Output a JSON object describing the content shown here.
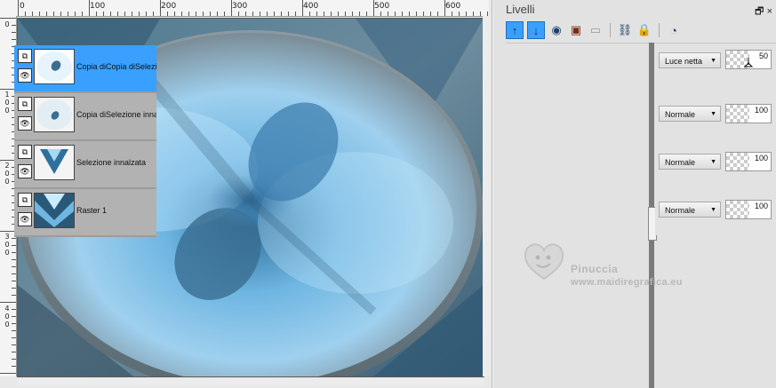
{
  "ruler": {
    "h_labels": [
      "0",
      "100",
      "200",
      "300",
      "400",
      "500",
      "600"
    ],
    "v_labels": [
      "0",
      "1\n0\n0",
      "2\n0\n0",
      "3\n0\n0",
      "4\n0\n0"
    ]
  },
  "layers_panel": {
    "title": "Livelli",
    "pin_icon": "pin-icon",
    "close_label": "×",
    "toolbar": [
      {
        "name": "move-up-icon",
        "glyph": "🠕"
      },
      {
        "name": "move-down-icon",
        "glyph": "🠗"
      },
      {
        "name": "new-raster-layer-icon",
        "glyph": "◉"
      },
      {
        "name": "new-mask-layer-icon",
        "glyph": "▣"
      },
      {
        "name": "delete-layer-icon",
        "glyph": "🗐"
      },
      {
        "name": "link-icon",
        "glyph": "🔗"
      },
      {
        "name": "lock-icon",
        "glyph": "🔒"
      },
      {
        "name": "properties-icon",
        "glyph": "◔"
      }
    ],
    "layers": [
      {
        "name": "Copia diCopia diSelezi",
        "blend": "Luce netta",
        "opacity": "50",
        "selected": true
      },
      {
        "name": "Copia diSelezione inna",
        "blend": "Normale",
        "opacity": "100",
        "selected": false
      },
      {
        "name": "Selezione innalzata",
        "blend": "Normale",
        "opacity": "100",
        "selected": false
      },
      {
        "name": "Raster 1",
        "blend": "Normale",
        "opacity": "100",
        "selected": false
      }
    ]
  },
  "watermark": {
    "line1": "Pinuccia",
    "line2": "www.maidiregrafica.eu"
  },
  "colors": {
    "selected": "#3aa0ff",
    "accent_blue": "#1f6fb8"
  }
}
